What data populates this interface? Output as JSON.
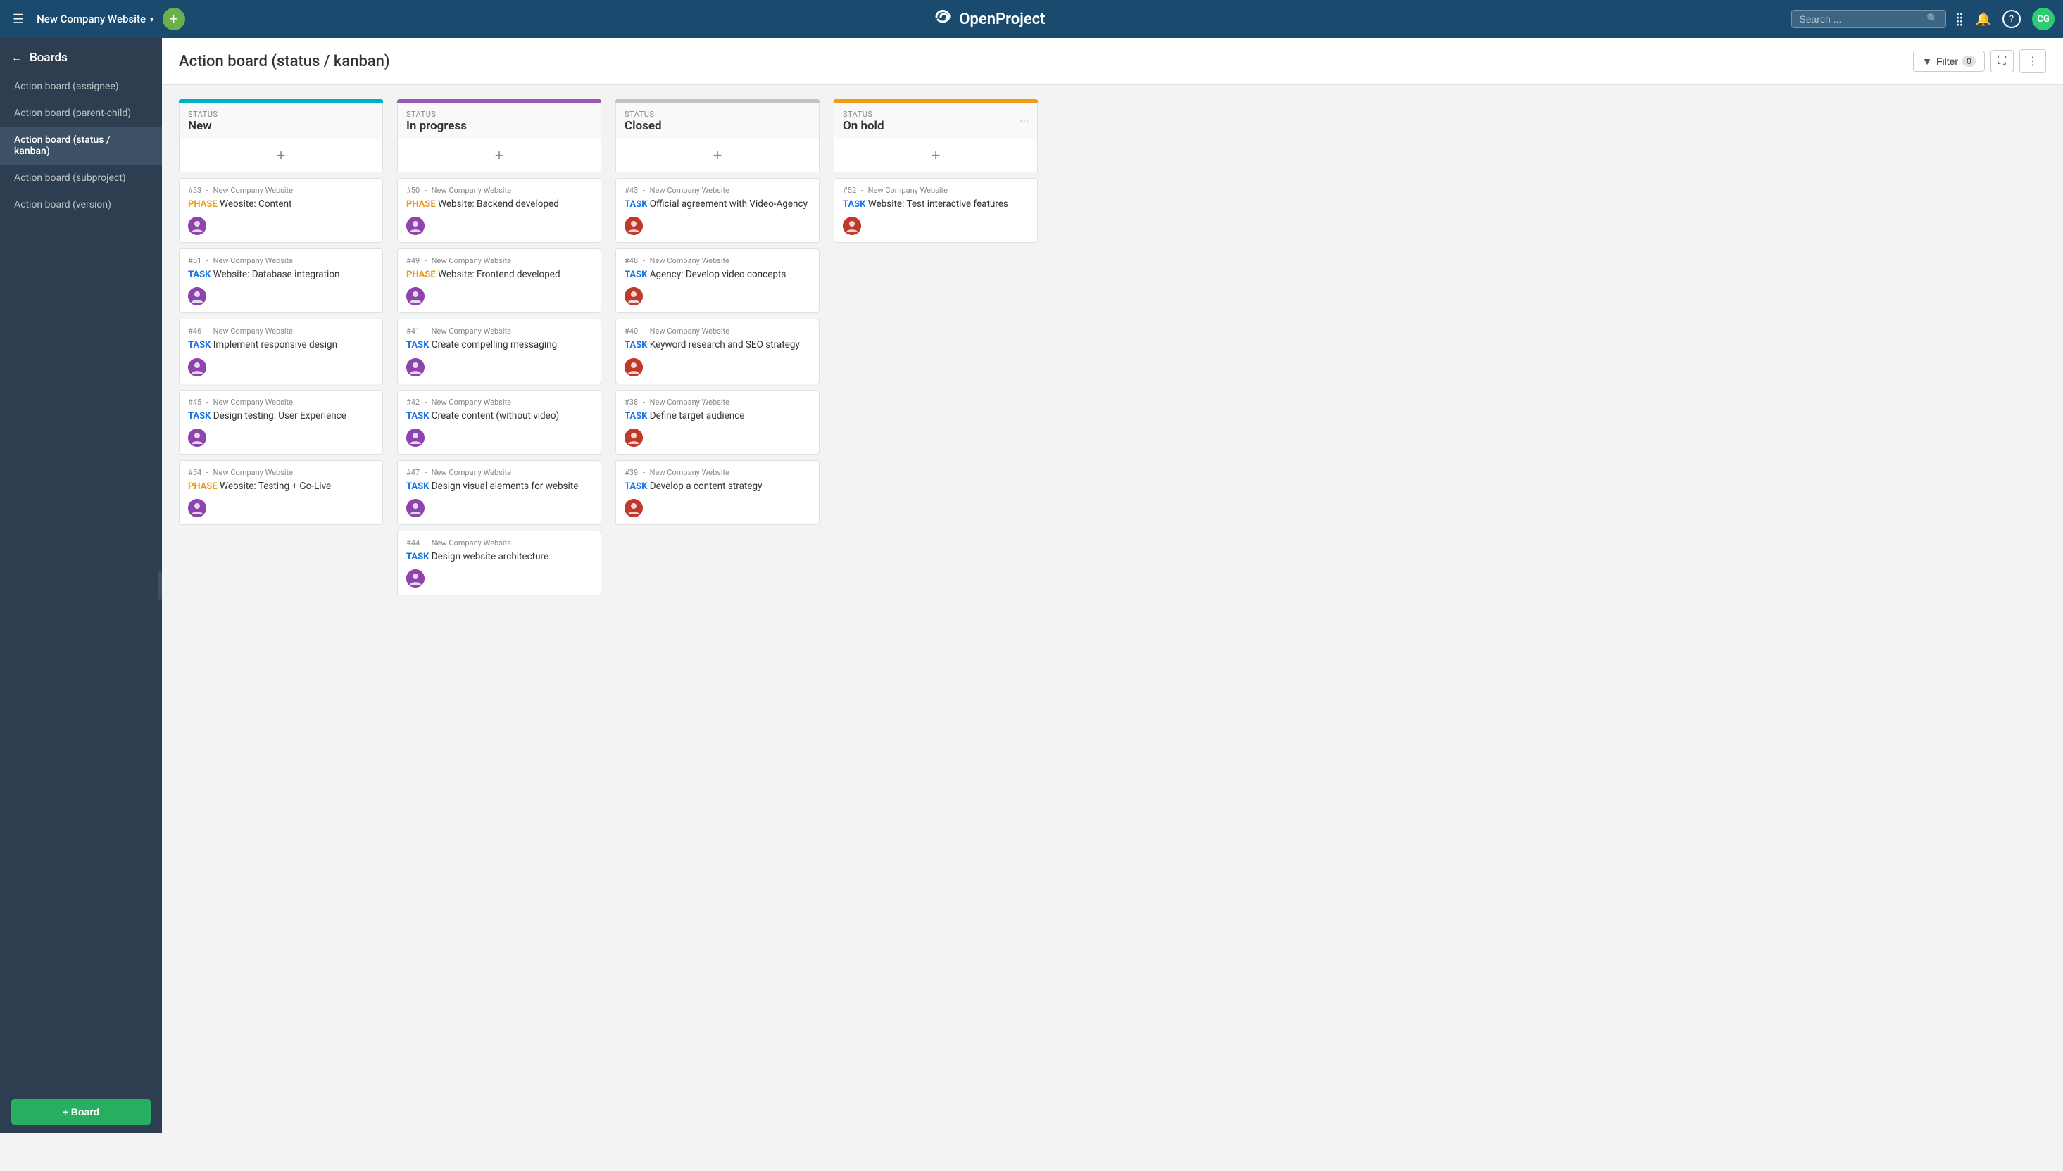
{
  "topnav": {
    "hamburger": "☰",
    "project_name": "New Company Website",
    "caret": "▾",
    "plus": "+",
    "logo_text": "OpenProject",
    "search_placeholder": "Search ...",
    "nav_icons": [
      "⣿",
      "🔔",
      "?"
    ],
    "avatar_text": "CG",
    "avatar_bg": "#2ecc71"
  },
  "sidebar": {
    "back_arrow": "←",
    "header_label": "Boards",
    "items": [
      {
        "label": "Action board (assignee)",
        "active": false
      },
      {
        "label": "Action board (parent-child)",
        "active": false
      },
      {
        "label": "Action board (status / kanban)",
        "active": true
      },
      {
        "label": "Action board (subproject)",
        "active": false
      },
      {
        "label": "Action board (version)",
        "active": false
      }
    ],
    "add_board_label": "+ Board"
  },
  "page": {
    "title": "Action board (status / kanban)",
    "filter_label": "Filter",
    "filter_count": "0",
    "fullscreen_icon": "⛶",
    "more_icon": "⋮"
  },
  "columns": [
    {
      "id": "new",
      "color": "#00b0c8",
      "status_label": "Status",
      "title": "New",
      "has_options": false,
      "cards": [
        {
          "num": "#53",
          "project": "New Company Website",
          "type": "PHASE",
          "type_class": "type-phase",
          "title": "Website: Content",
          "avatar_color": "#8e44ad"
        },
        {
          "num": "#51",
          "project": "New Company Website",
          "type": "TASK",
          "type_class": "type-task",
          "title": "Website: Database integration",
          "avatar_color": "#8e44ad"
        },
        {
          "num": "#46",
          "project": "New Company Website",
          "type": "TASK",
          "type_class": "type-task",
          "title": "Implement responsive design",
          "avatar_color": "#8e44ad"
        },
        {
          "num": "#45",
          "project": "New Company Website",
          "type": "TASK",
          "type_class": "type-task",
          "title": "Design testing: User Experience",
          "avatar_color": "#8e44ad"
        },
        {
          "num": "#54",
          "project": "New Company Website",
          "type": "PHASE",
          "type_class": "type-phase",
          "title": "Website: Testing + Go-Live",
          "avatar_color": "#8e44ad"
        }
      ]
    },
    {
      "id": "in-progress",
      "color": "#9b59b6",
      "status_label": "Status",
      "title": "In progress",
      "has_options": false,
      "cards": [
        {
          "num": "#50",
          "project": "New Company Website",
          "type": "PHASE",
          "type_class": "type-phase",
          "title": "Website: Backend developed",
          "avatar_color": "#8e44ad"
        },
        {
          "num": "#49",
          "project": "New Company Website",
          "type": "PHASE",
          "type_class": "type-phase",
          "title": "Website: Frontend developed",
          "avatar_color": "#8e44ad"
        },
        {
          "num": "#41",
          "project": "New Company Website",
          "type": "TASK",
          "type_class": "type-task",
          "title": "Create compelling messaging",
          "avatar_color": "#8e44ad"
        },
        {
          "num": "#42",
          "project": "New Company Website",
          "type": "TASK",
          "type_class": "type-task",
          "title": "Create content (without video)",
          "avatar_color": "#8e44ad"
        },
        {
          "num": "#47",
          "project": "New Company Website",
          "type": "TASK",
          "type_class": "type-task",
          "title": "Design visual elements for website",
          "avatar_color": "#8e44ad"
        },
        {
          "num": "#44",
          "project": "New Company Website",
          "type": "TASK",
          "type_class": "type-task",
          "title": "Design website architecture",
          "avatar_color": "#8e44ad"
        }
      ]
    },
    {
      "id": "closed",
      "color": "#bdc3c7",
      "status_label": "Status",
      "title": "Closed",
      "has_options": false,
      "cards": [
        {
          "num": "#43",
          "project": "New Company Website",
          "type": "TASK",
          "type_class": "type-task",
          "title": "Official agreement with Video-Agency",
          "avatar_color": "#c0392b"
        },
        {
          "num": "#48",
          "project": "New Company Website",
          "type": "TASK",
          "type_class": "type-task",
          "title": "Agency: Develop video concepts",
          "avatar_color": "#c0392b"
        },
        {
          "num": "#40",
          "project": "New Company Website",
          "type": "TASK",
          "type_class": "type-task",
          "title": "Keyword research and SEO strategy",
          "avatar_color": "#c0392b"
        },
        {
          "num": "#38",
          "project": "New Company Website",
          "type": "TASK",
          "type_class": "type-task",
          "title": "Define target audience",
          "avatar_color": "#c0392b"
        },
        {
          "num": "#39",
          "project": "New Company Website",
          "type": "TASK",
          "type_class": "type-task",
          "title": "Develop a content strategy",
          "avatar_color": "#c0392b"
        }
      ]
    },
    {
      "id": "on-hold",
      "color": "#f39c12",
      "status_label": "Status",
      "title": "On hold",
      "has_options": true,
      "cards": [
        {
          "num": "#52",
          "project": "New Company Website",
          "type": "TASK",
          "type_class": "type-task",
          "title": "Website: Test interactive features",
          "avatar_color": "#c0392b"
        }
      ]
    }
  ]
}
